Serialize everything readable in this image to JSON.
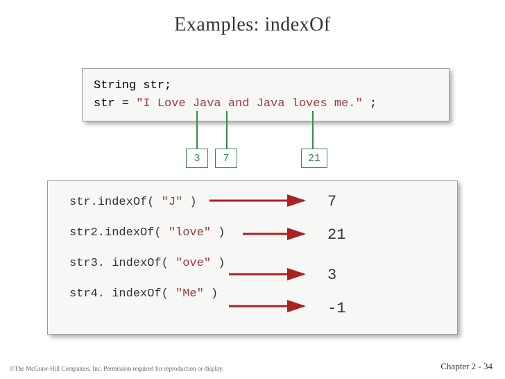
{
  "title": "Examples: indexOf",
  "decl_line1": "String str;",
  "decl_prefix": "str = ",
  "decl_literal": "\"I Love Java and Java loves me.\"",
  "decl_suffix": " ;",
  "index_labels": {
    "a": "3",
    "b": "7",
    "c": "21"
  },
  "calls": [
    {
      "pre": "str.indexOf( ",
      "arg": "\"J\"",
      "post": " )"
    },
    {
      "pre": "str2.indexOf( ",
      "arg": "\"love\"",
      "post": " )"
    },
    {
      "pre": "str3. indexOf( ",
      "arg": "\"ove\"",
      "post": " )"
    },
    {
      "pre": "str4. indexOf( ",
      "arg": "\"Me\"",
      "post": " )"
    }
  ],
  "results": {
    "r1": "7",
    "r2": "21",
    "r3": "3",
    "r4": "-1"
  },
  "footer_left": "©The McGraw-Hill Companies, Inc. Permission required for reproduction or display.",
  "footer_right": "Chapter 2 - 34"
}
